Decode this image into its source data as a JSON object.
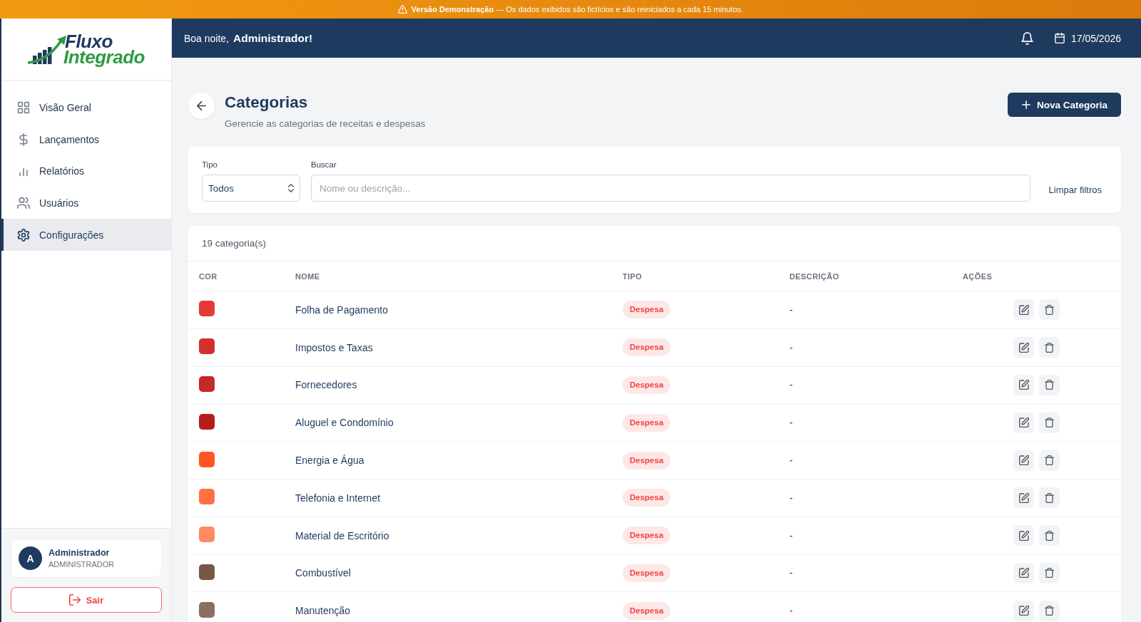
{
  "banner": {
    "text": "**Versão Demonstração** — Os dados exibidos são fictícios e são reiniciados a cada 15 minutos."
  },
  "sidebar": {
    "logo": {
      "line_1": "Fluxo",
      "line_2": "Integrado"
    },
    "items": [
      {
        "label": "Visão Geral",
        "selected": false
      },
      {
        "label": "Lançamentos",
        "selected": false
      },
      {
        "label": "Relatórios",
        "selected": false
      },
      {
        "label": "Usuários",
        "selected": false
      },
      {
        "label": "Configurações",
        "selected": true
      }
    ],
    "user": {
      "initial": "A",
      "name": "Administrador",
      "role": "ADMINISTRADOR"
    },
    "logout_button": "Sair"
  },
  "header": {
    "greeting": "Boa noite,",
    "user_name": "Administrador!",
    "date": "17/05/2026"
  },
  "page": {
    "title": "Categorias",
    "subtitle": "Gerencie as categorias de receitas e despesas",
    "new_button": "Nova Categoria"
  },
  "filters": {
    "type": {
      "label": "Tipo",
      "value": "Todos"
    },
    "search": {
      "label": "Buscar",
      "placeholder": "Nome ou descrição..."
    },
    "clear_button": "Limpar filtros"
  },
  "table": {
    "count": "19 categoria(s)",
    "columns": [
      "COR",
      "NOME",
      "TIPO",
      "DESCRIÇÃO",
      "AÇÕES"
    ],
    "rows": [
      {
        "color": "#e53935",
        "name": "Folha de Pagamento",
        "type": "Despesa",
        "description": "-"
      },
      {
        "color": "#d32f2f",
        "name": "Impostos e Taxas",
        "type": "Despesa",
        "description": "-"
      },
      {
        "color": "#c62828",
        "name": "Fornecedores",
        "type": "Despesa",
        "description": "-"
      },
      {
        "color": "#b71c1c",
        "name": "Aluguel e Condomínio",
        "type": "Despesa",
        "description": "-"
      },
      {
        "color": "#ff5722",
        "name": "Energia e Água",
        "type": "Despesa",
        "description": "-"
      },
      {
        "color": "#ff7043",
        "name": "Telefonia e Internet",
        "type": "Despesa",
        "description": "-"
      },
      {
        "color": "#ff8a65",
        "name": "Material de Escritório",
        "type": "Despesa",
        "description": "-"
      },
      {
        "color": "#795548",
        "name": "Combustível",
        "type": "Despesa",
        "description": "-"
      },
      {
        "color": "#8d6e63",
        "name": "Manutenção",
        "type": "Despesa",
        "description": "-"
      }
    ]
  }
}
